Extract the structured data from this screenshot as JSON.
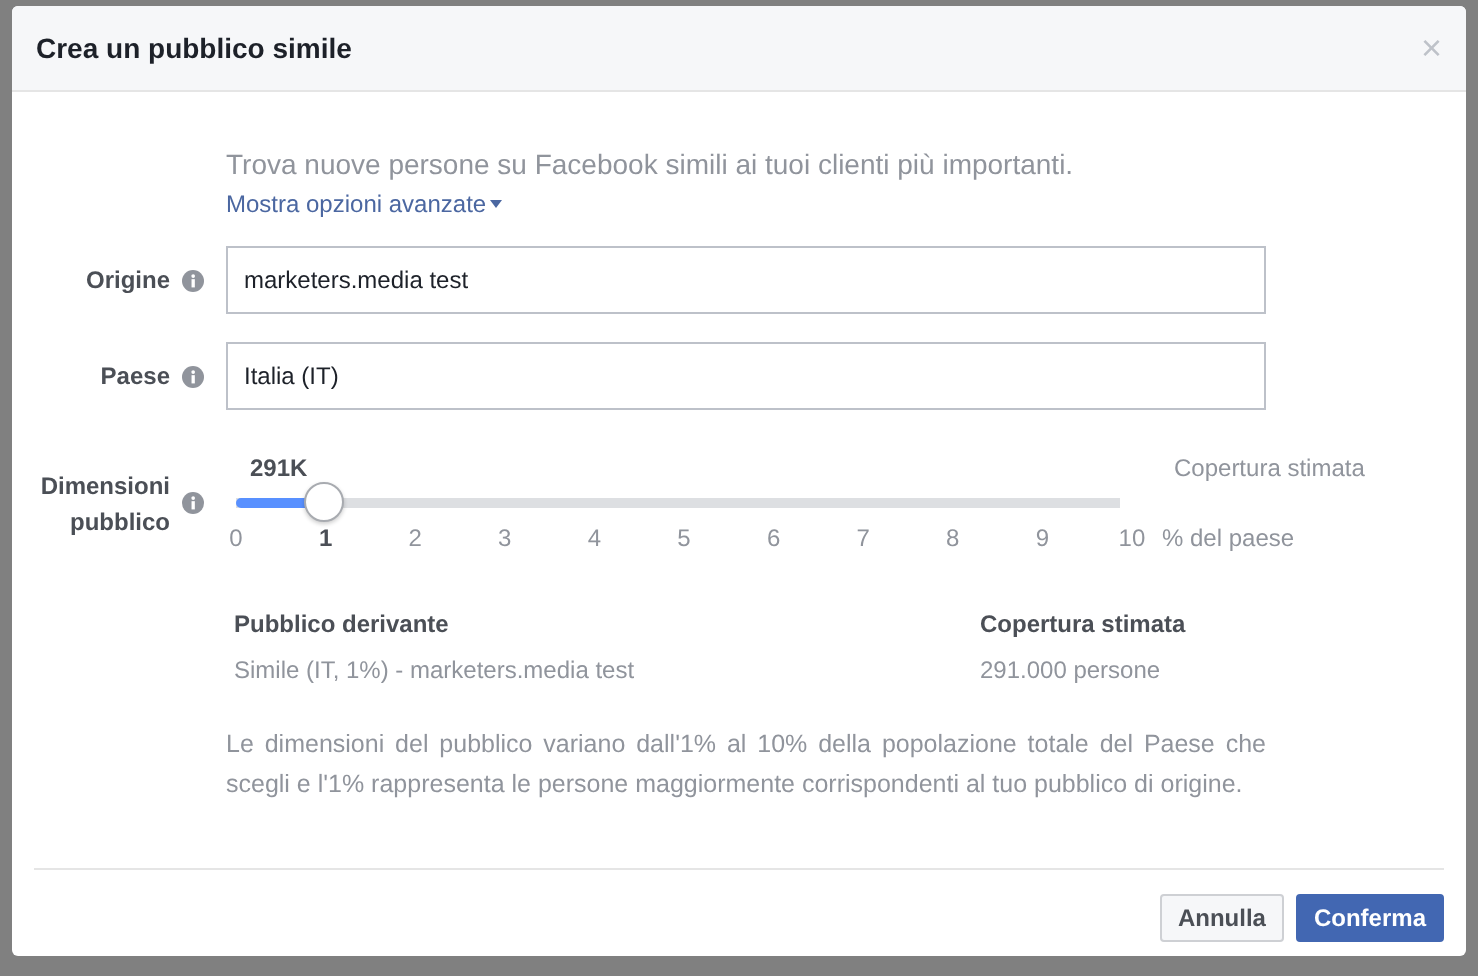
{
  "dialog": {
    "title": "Crea un pubblico simile",
    "close": "×",
    "intro": "Trova nuove persone su Facebook simili ai tuoi clienti più importanti.",
    "advanced_link": "Mostra opzioni avanzate",
    "fields": [
      {
        "label": "Origine",
        "value": "marketers.media test"
      },
      {
        "label": "Paese",
        "value": "Italia (IT)"
      }
    ],
    "size": {
      "label": "Dimensioni pubblico",
      "reach": "291K",
      "reach_caption": "Copertura stimata",
      "level": 0.1,
      "ticks": [
        {
          "label": "0",
          "selected": false
        },
        {
          "label": "1",
          "selected": true
        },
        {
          "label": "2",
          "selected": false
        },
        {
          "label": "3",
          "selected": false
        },
        {
          "label": "4",
          "selected": false
        },
        {
          "label": "5",
          "selected": false
        },
        {
          "label": "6",
          "selected": false
        },
        {
          "label": "7",
          "selected": false
        },
        {
          "label": "8",
          "selected": false
        },
        {
          "label": "9",
          "selected": false
        },
        {
          "label": "10",
          "selected": false
        }
      ],
      "unit": "% del paese"
    },
    "table": {
      "columns": [
        "Pubblico derivante",
        "Copertura stimata"
      ],
      "rows": [
        [
          "Simile (IT, 1%) - marketers.media test",
          "291.000 persone"
        ]
      ]
    },
    "note": "Le dimensioni del pubblico variano dall'1% al 10% della popolazione totale del Paese che scegli e l'1% rappresenta le persone maggiormente corrispondenti al tuo pubblico di origine.",
    "buttons": [
      {
        "label": "Annulla",
        "kind": "secondary"
      },
      {
        "label": "Conferma",
        "kind": "primary"
      }
    ]
  }
}
